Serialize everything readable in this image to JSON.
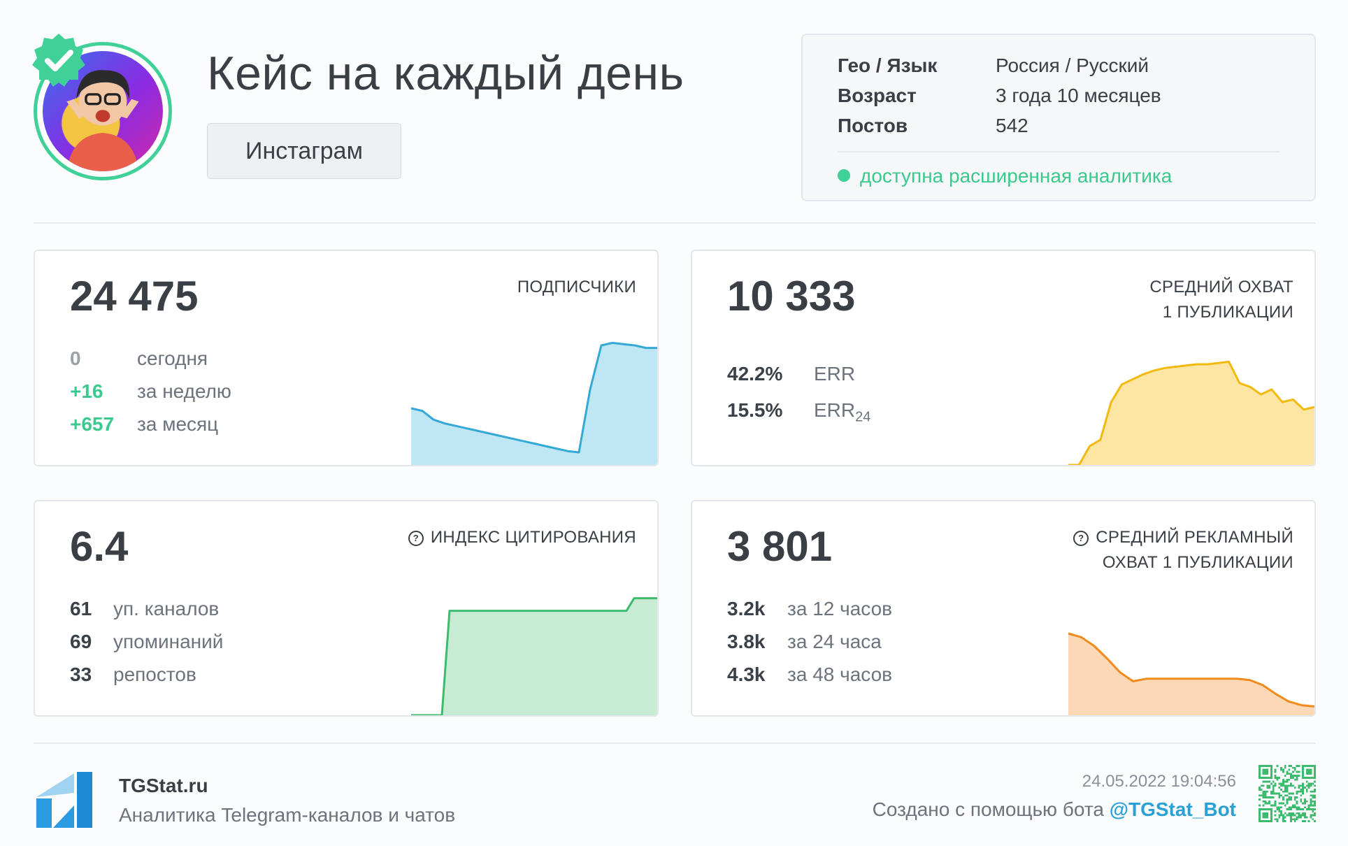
{
  "channel": {
    "title": "Кейс на каждый день",
    "platform_label": "Инстаграм"
  },
  "info": {
    "rows": [
      {
        "key": "Гео / Язык",
        "value": "Россия / Русский"
      },
      {
        "key": "Возраст",
        "value": "3 года 10 месяцев"
      },
      {
        "key": "Постов",
        "value": "542"
      }
    ],
    "analytics_note": "доступна расширенная аналитика"
  },
  "cards": {
    "subscribers": {
      "value": "24 475",
      "label": "ПОДПИСЧИКИ",
      "stats": [
        {
          "num": "0",
          "text": "сегодня"
        },
        {
          "num": "+16",
          "text": "за неделю"
        },
        {
          "num": "+657",
          "text": "за месяц"
        }
      ]
    },
    "reach": {
      "value": "10 333",
      "label_line1": "СРЕДНИЙ ОХВАТ",
      "label_line2": "1 ПУБЛИКАЦИИ",
      "stats": [
        {
          "num": "42.2%",
          "text": "ERR"
        },
        {
          "num": "15.5%",
          "text": "ERR",
          "sub": "24"
        }
      ]
    },
    "citation": {
      "value": "6.4",
      "label": "ИНДЕКС ЦИТИРОВАНИЯ",
      "stats": [
        {
          "num": "61",
          "text": "уп. каналов"
        },
        {
          "num": "69",
          "text": "упоминаний"
        },
        {
          "num": "33",
          "text": "репостов"
        }
      ]
    },
    "ad_reach": {
      "value": "3 801",
      "label_line1": "СРЕДНИЙ РЕКЛАМНЫЙ",
      "label_line2": "ОХВАТ 1 ПУБЛИКАЦИИ",
      "stats": [
        {
          "num": "3.2k",
          "text": "за 12 часов"
        },
        {
          "num": "3.8k",
          "text": "за 24 часа"
        },
        {
          "num": "4.3k",
          "text": "за 48 часов"
        }
      ]
    }
  },
  "sparklines": {
    "subscribers": {
      "color": "#35a9d6",
      "fill": "#bfe6f3",
      "values": [
        0.45,
        0.43,
        0.36,
        0.33,
        0.31,
        0.29,
        0.27,
        0.25,
        0.23,
        0.21,
        0.19,
        0.17,
        0.15,
        0.13,
        0.11,
        0.1,
        0.6,
        0.95,
        0.97,
        0.96,
        0.95,
        0.93,
        0.93
      ]
    },
    "reach": {
      "color": "#f2b90f",
      "fill": "#fde6a3",
      "values": [
        0.0,
        0.0,
        0.15,
        0.2,
        0.5,
        0.64,
        0.68,
        0.72,
        0.75,
        0.77,
        0.78,
        0.79,
        0.8,
        0.8,
        0.81,
        0.82,
        0.65,
        0.62,
        0.56,
        0.6,
        0.5,
        0.52,
        0.44,
        0.46
      ]
    },
    "citation": {
      "color": "#3dbb6d",
      "fill": "#c8ecd3",
      "values": [
        0.0,
        0.0,
        0.0,
        0.0,
        0.0,
        0.83,
        0.83,
        0.83,
        0.83,
        0.83,
        0.83,
        0.83,
        0.83,
        0.83,
        0.83,
        0.83,
        0.83,
        0.83,
        0.83,
        0.83,
        0.83,
        0.83,
        0.83,
        0.83,
        0.83,
        0.83,
        0.83,
        0.83,
        0.83,
        0.93,
        0.93,
        0.93,
        0.93
      ]
    },
    "ad_reach": {
      "color": "#f08b1c",
      "fill": "#fcd8b7",
      "values": [
        0.65,
        0.62,
        0.55,
        0.45,
        0.34,
        0.27,
        0.29,
        0.29,
        0.29,
        0.29,
        0.29,
        0.29,
        0.29,
        0.29,
        0.28,
        0.24,
        0.17,
        0.11,
        0.08,
        0.07
      ]
    }
  },
  "footer": {
    "brand": "TGStat.ru",
    "brand_sub": "Аналитика Telegram-каналов и чатов",
    "date": "24.05.2022 19:04:56",
    "created_prefix": "Создано с помощью бота ",
    "bot_handle": "@TGStat_Bot"
  },
  "colors": {
    "accent_green": "#3fd197",
    "accent_blue": "#2aa1d6",
    "positive": "#3cc98d"
  }
}
